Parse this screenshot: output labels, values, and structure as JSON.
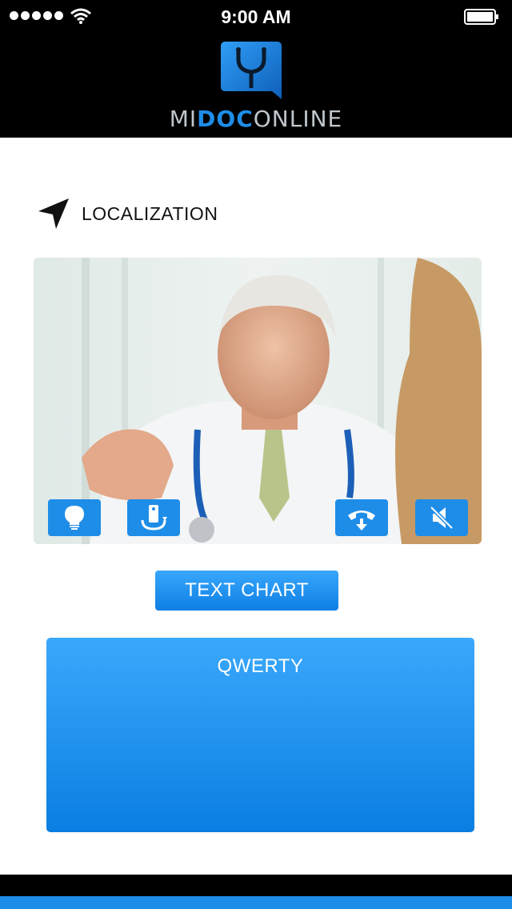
{
  "status_bar": {
    "time": "9:00 AM",
    "signal_icon": "signal-dots-icon",
    "wifi_icon": "wifi-icon",
    "battery_icon": "battery-icon"
  },
  "header": {
    "logo_prefix": "MI",
    "logo_accent": "DOC",
    "logo_suffix": "ONLINE",
    "logo_icon": "stethoscope-chat-icon",
    "colors": {
      "background": "#000000",
      "accent": "#1e8de8",
      "text": "#bfc6cc"
    }
  },
  "localization": {
    "label": "LOCALIZATION",
    "icon": "location-arrow-icon"
  },
  "video": {
    "controls": [
      {
        "name": "light-bulb-icon"
      },
      {
        "name": "rotate-phone-icon"
      },
      {
        "name": "hang-up-icon"
      },
      {
        "name": "mute-icon"
      }
    ]
  },
  "text_chart_button": {
    "label": "TEXT CHART"
  },
  "text_area": {
    "value": "QWERTY"
  },
  "colors": {
    "primary": "#1e8de8",
    "primary_light": "#38a7fb"
  }
}
